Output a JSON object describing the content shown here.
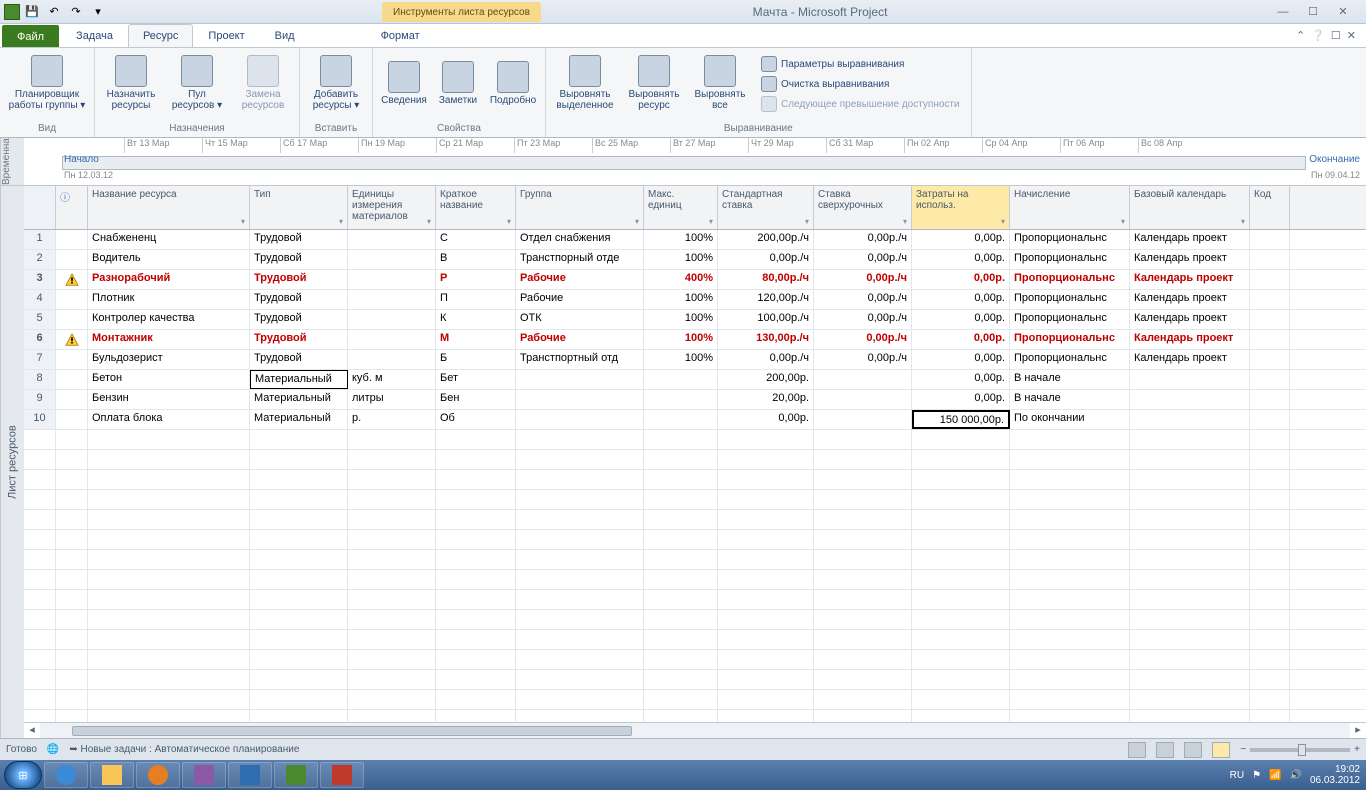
{
  "titlebar": {
    "doc_title": "Мачта - Microsoft Project"
  },
  "tabs": {
    "file": "Файл",
    "task": "Задача",
    "resource": "Ресурс",
    "project": "Проект",
    "view": "Вид",
    "contextual_group": "Инструменты листа ресурсов",
    "format": "Формат"
  },
  "ribbon": {
    "view": {
      "team_planner": "Планировщик\nработы группы ▾",
      "group": "Вид"
    },
    "assignments": {
      "assign": "Назначить\nресурсы",
      "pool": "Пул\nресурсов ▾",
      "substitute": "Замена\nресурсов",
      "group": "Назначения"
    },
    "insert": {
      "add": "Добавить\nресурсы ▾",
      "group": "Вставить"
    },
    "properties": {
      "info": "Сведения",
      "notes": "Заметки",
      "details": "Подробно",
      "group": "Свойства"
    },
    "level": {
      "sel": "Выровнять\nвыделенное",
      "res": "Выровнять\nресурс",
      "all": "Выровнять\nвсе",
      "opts": "Параметры выравнивания",
      "clear": "Очистка выравнивания",
      "next": "Следующее превышение доступности",
      "group": "Выравнивание"
    }
  },
  "timeline": {
    "side": "Временна",
    "ticks": [
      "Вт 13 Мар",
      "Чт 15 Мар",
      "Сб 17 Мар",
      "Пн 19 Мар",
      "Ср 21 Мар",
      "Пт 23 Мар",
      "Вс 25 Мар",
      "Вт 27 Мар",
      "Чт 29 Мар",
      "Сб 31 Мар",
      "Пн 02 Апр",
      "Ср 04 Апр",
      "Пт 06 Апр",
      "Вс 08 Апр"
    ],
    "start": "Начало",
    "start_date": "Пн 12.03.12",
    "end": "Окончание",
    "end_date": "Пн 09.04.12"
  },
  "sheet": {
    "side": "Лист ресурсов",
    "columns": [
      "",
      "Название ресурса",
      "Тип",
      "Единицы измерения материалов",
      "Краткое название",
      "Группа",
      "Макс. единиц",
      "Стандартная ставка",
      "Ставка сверхурочных",
      "Затраты на использ.",
      "Начисление",
      "Базовый календарь",
      "Код"
    ],
    "rows": [
      {
        "n": 1,
        "w": false,
        "name": "Снабжененц",
        "type": "Трудовой",
        "unit": "",
        "short": "С",
        "group": "Отдел снабжения",
        "max": "100%",
        "std": "200,00р./ч",
        "ovt": "0,00р./ч",
        "cost": "0,00р.",
        "accr": "Пропорциональнс",
        "cal": "Календарь проект",
        "over": false
      },
      {
        "n": 2,
        "w": false,
        "name": "Водитель",
        "type": "Трудовой",
        "unit": "",
        "short": "В",
        "group": "Транстпорный отде",
        "max": "100%",
        "std": "0,00р./ч",
        "ovt": "0,00р./ч",
        "cost": "0,00р.",
        "accr": "Пропорциональнс",
        "cal": "Календарь проект",
        "over": false
      },
      {
        "n": 3,
        "w": true,
        "name": "Разнорабочий",
        "type": "Трудовой",
        "unit": "",
        "short": "Р",
        "group": "Рабочие",
        "max": "400%",
        "std": "80,00р./ч",
        "ovt": "0,00р./ч",
        "cost": "0,00р.",
        "accr": "Пропорциональнс",
        "cal": "Календарь проект",
        "over": true
      },
      {
        "n": 4,
        "w": false,
        "name": "Плотник",
        "type": "Трудовой",
        "unit": "",
        "short": "П",
        "group": "Рабочие",
        "max": "100%",
        "std": "120,00р./ч",
        "ovt": "0,00р./ч",
        "cost": "0,00р.",
        "accr": "Пропорциональнс",
        "cal": "Календарь проект",
        "over": false
      },
      {
        "n": 5,
        "w": false,
        "name": "Контролер качества",
        "type": "Трудовой",
        "unit": "",
        "short": "К",
        "group": "ОТК",
        "max": "100%",
        "std": "100,00р./ч",
        "ovt": "0,00р./ч",
        "cost": "0,00р.",
        "accr": "Пропорциональнс",
        "cal": "Календарь проект",
        "over": false
      },
      {
        "n": 6,
        "w": true,
        "name": "Монтажник",
        "type": "Трудовой",
        "unit": "",
        "short": "М",
        "group": "Рабочие",
        "max": "100%",
        "std": "130,00р./ч",
        "ovt": "0,00р./ч",
        "cost": "0,00р.",
        "accr": "Пропорциональнс",
        "cal": "Календарь проект",
        "over": true
      },
      {
        "n": 7,
        "w": false,
        "name": "Бульдозерист",
        "type": "Трудовой",
        "unit": "",
        "short": "Б",
        "group": "Транстпортный отд",
        "max": "100%",
        "std": "0,00р./ч",
        "ovt": "0,00р./ч",
        "cost": "0,00р.",
        "accr": "Пропорциональнс",
        "cal": "Календарь проект",
        "over": false
      },
      {
        "n": 8,
        "w": false,
        "name": "Бетон",
        "type": "Материальный",
        "unit": "куб. м",
        "short": "Бет",
        "group": "",
        "max": "",
        "std": "200,00р.",
        "ovt": "",
        "cost": "0,00р.",
        "accr": "В начале",
        "cal": "",
        "over": false,
        "editing": true
      },
      {
        "n": 9,
        "w": false,
        "name": "Бензин",
        "type": "Материальный",
        "unit": "литры",
        "short": "Бен",
        "group": "",
        "max": "",
        "std": "20,00р.",
        "ovt": "",
        "cost": "0,00р.",
        "accr": "В начале",
        "cal": "",
        "over": false
      },
      {
        "n": 10,
        "w": false,
        "name": "Оплата блока",
        "type": "Материальный",
        "unit": "р.",
        "short": "Об",
        "group": "",
        "max": "",
        "std": "0,00р.",
        "ovt": "",
        "cost": "150 000,00р.",
        "accr": "По окончании",
        "cal": "",
        "over": false,
        "sel_cost": true
      }
    ]
  },
  "statusbar": {
    "ready": "Готово",
    "new_tasks": "Новые задачи : Автоматическое планирование"
  },
  "tray": {
    "lang": "RU",
    "time": "19:02",
    "date": "06.03.2012"
  }
}
